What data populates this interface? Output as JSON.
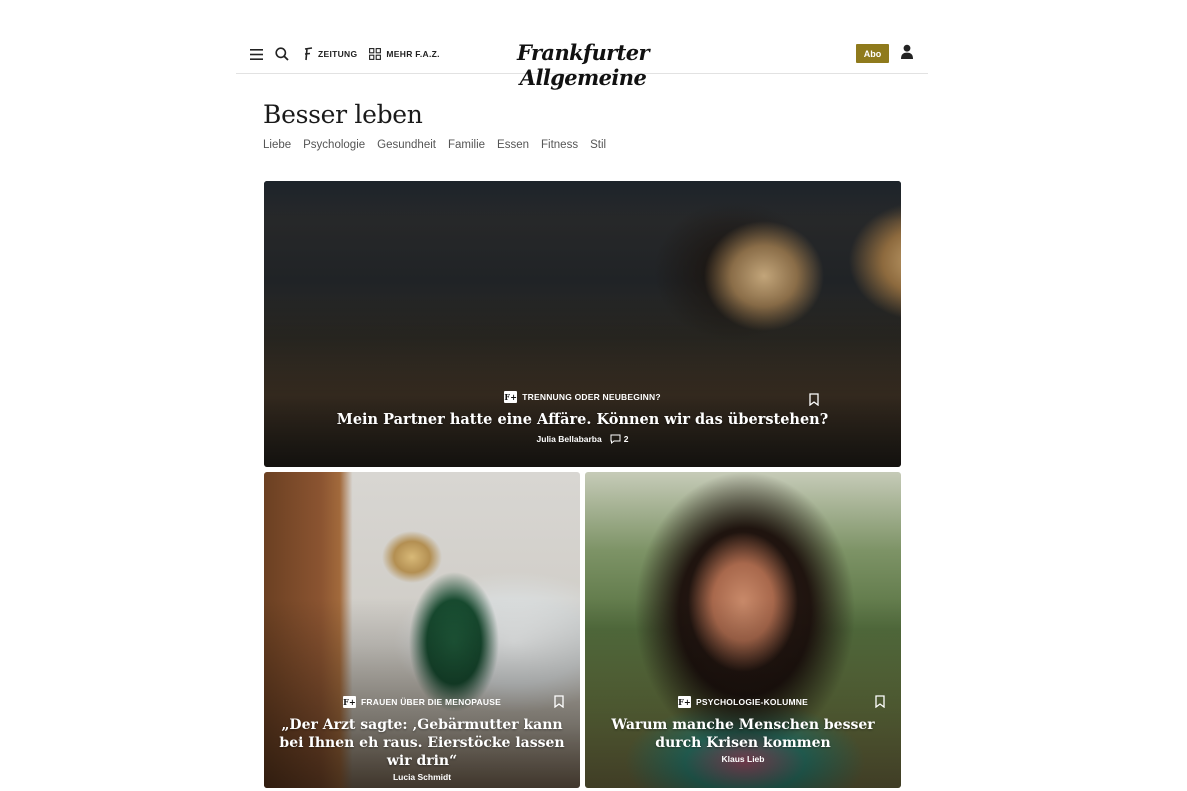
{
  "header": {
    "menu_icon": "menu-icon",
    "search_icon": "search-icon",
    "zeitung_label": "ZEITUNG",
    "mehr_label": "MEHR F.A.Z.",
    "logo_text": "Frankfurter Allgemeine",
    "abo_label": "Abo",
    "user_icon": "user-icon",
    "abo_color": "#8f7a1c"
  },
  "page": {
    "title": "Besser leben",
    "subnav": [
      "Liebe",
      "Psychologie",
      "Gesundheit",
      "Familie",
      "Essen",
      "Fitness",
      "Stil"
    ]
  },
  "articles": [
    {
      "kicker": "TRENNUNG ODER NEUBEGINN?",
      "headline": "Mein Partner hatte eine Affäre. Können wir das überstehen?",
      "author": "Julia Bellabarba",
      "comments": "2",
      "badge": "F+"
    },
    {
      "kicker": "FRAUEN ÜBER DIE MENOPAUSE",
      "headline": "„Der Arzt sagte: ‚Gebärmutter kann bei Ihnen eh raus. Eierstöcke lassen wir drin“",
      "author": "Lucia Schmidt",
      "badge": "F+"
    },
    {
      "kicker": "PSYCHOLOGIE-KOLUMNE",
      "headline": "Warum manche Menschen besser durch Krisen kommen",
      "author": "Klaus Lieb",
      "badge": "F+"
    }
  ]
}
